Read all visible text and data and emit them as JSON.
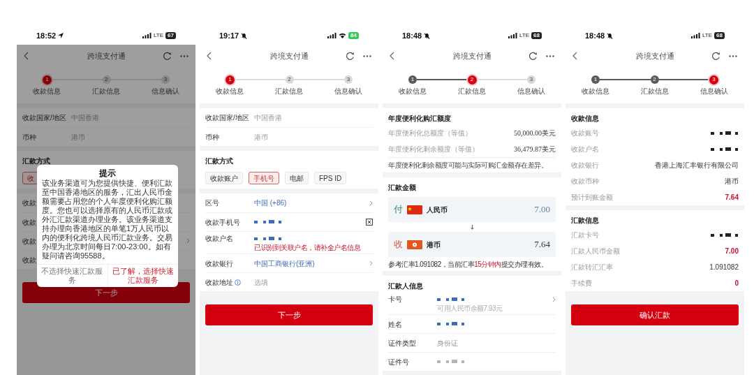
{
  "phones": [
    {
      "status": {
        "time": "18:52",
        "location_icon": true,
        "network": "LTE",
        "battery": "67",
        "charging": false
      },
      "title": "跨境支付通",
      "steps": [
        {
          "number": "1",
          "label": "收款信息",
          "done": false,
          "selected": true
        },
        {
          "number": "2",
          "label": "汇款信息",
          "done": false,
          "selected": false
        },
        {
          "number": "3",
          "label": "信息确认",
          "done": false,
          "selected": false
        }
      ],
      "sections": [
        {
          "kind": "form",
          "rows": [
            {
              "label": "收款国家/地区",
              "value": "中国香港",
              "kind": "muted"
            },
            {
              "label": "币种",
              "value": "港币",
              "kind": "muted"
            }
          ]
        },
        {
          "kind": "chips",
          "title": "汇款方式",
          "chips": [
            {
              "label": "收",
              "selected": true
            }
          ]
        },
        {
          "kind": "form",
          "rows": [
            {
              "label": "收款"
            },
            {
              "label": "收款"
            },
            {
              "label": "收款",
              "chevron": true
            },
            {
              "label": "收款"
            }
          ]
        },
        {
          "kind": "button",
          "label": "下一步"
        }
      ],
      "dialog": {
        "title": "提示",
        "body": "该业务渠道可为您提供快捷、便利汇款至中国香港地区的服务，汇出人民币金额需要占用您的个人年度便利化购汇额度。您也可以选择原有的人民币汇款或外汇汇款渠道办理业务。该业务渠道支持办理向香港地区的单笔1万人民币以内的便利化跨境人民币汇款业务。交易办理为北京时间每日7:00-23:00。如有疑问请咨询95588。",
        "buttons": [
          {
            "label": "不选择快速汇款服务",
            "kind": "secondary"
          },
          {
            "label": "已了解，选择快速汇款服务",
            "kind": "primary"
          }
        ]
      }
    },
    {
      "status": {
        "time": "19:17",
        "silent_icon": true,
        "wifi": true,
        "battery": "84",
        "charging": true
      },
      "title": "跨境支付通",
      "steps": [
        {
          "number": "1",
          "label": "收款信息",
          "done": false,
          "selected": true
        },
        {
          "number": "2",
          "label": "汇款信息",
          "done": false,
          "selected": false
        },
        {
          "number": "3",
          "label": "信息确认",
          "done": false,
          "selected": false
        }
      ],
      "sections": [
        {
          "kind": "form",
          "rows": [
            {
              "label": "收款国家/地区",
              "value": "中国香港",
              "kind": "muted"
            },
            {
              "label": "币种",
              "value": "港币",
              "kind": "muted"
            }
          ]
        },
        {
          "kind": "chips",
          "title": "汇款方式",
          "chips": [
            {
              "label": "收款账户",
              "selected": false
            },
            {
              "label": "手机号",
              "selected": true
            },
            {
              "label": "电邮",
              "selected": false
            },
            {
              "label": "FPS ID",
              "selected": false
            }
          ]
        },
        {
          "kind": "form",
          "rows": [
            {
              "label": "区号",
              "value": "中国 (+86)",
              "kind": "link",
              "chevron": true
            },
            {
              "label": "收款手机号",
              "masked": true,
              "kind": "link",
              "contact_icon": true
            },
            {
              "label": "收款户名",
              "masked": true,
              "kind": "link",
              "note": "已识别到关联户名，请补全户名信息",
              "note_error": true
            },
            {
              "label": "收款银行",
              "value": "中国工商银行(亚洲)",
              "kind": "link",
              "chevron": true
            },
            {
              "label": "收款地址",
              "info_icon": true,
              "placeholder": "选填"
            }
          ]
        },
        {
          "kind": "button",
          "label": "下一步"
        }
      ]
    },
    {
      "status": {
        "time": "18:48",
        "silent_icon": true,
        "network": "LTE",
        "battery": "68",
        "charging": false
      },
      "title": "跨境支付通",
      "steps": [
        {
          "number": "1",
          "label": "收款信息",
          "done": true,
          "selected": false
        },
        {
          "number": "2",
          "label": "汇款信息",
          "done": false,
          "selected": true
        },
        {
          "number": "3",
          "label": "信息确认",
          "done": false,
          "selected": false
        }
      ],
      "sections": [
        {
          "kind": "summary",
          "title": "年度便利化购汇额度",
          "rows": [
            {
              "label": "年度便利化总额度（等值）",
              "value": "50,000.00美元",
              "kind": "serif"
            },
            {
              "label": "年度便利化剩余额度（等值）",
              "value": "36,479.87美元",
              "kind": "serif"
            }
          ],
          "note": "年度便利化剩余额度可能与实际可购汇金额存在差异。"
        },
        {
          "kind": "exchange",
          "title": "汇款金额",
          "legs": [
            {
              "kind": "pay",
              "mark": "付",
              "currency": "人民币",
              "amount": "7.00"
            },
            {
              "kind": "receive",
              "mark": "收",
              "currency": "港币",
              "amount": "7.64"
            }
          ],
          "note_parts": [
            {
              "text": "参考汇率1.091082，当前汇率",
              "highlight": false
            },
            {
              "text": "15分钟内",
              "highlight": true
            },
            {
              "text": "提交办理有效。",
              "highlight": false
            }
          ]
        },
        {
          "kind": "form",
          "title": "汇款人信息",
          "rows": [
            {
              "label": "卡号",
              "masked": true,
              "kind": "link",
              "note": "可用人民币余额7.93元",
              "note_error": false,
              "chevron": true
            },
            {
              "label": "姓名",
              "masked": true,
              "kind": "link"
            },
            {
              "label": "证件类型",
              "value": "身份证",
              "kind": "muted"
            },
            {
              "label": "证件号",
              "masked": true,
              "kind": "muted"
            }
          ]
        }
      ]
    },
    {
      "status": {
        "time": "18:48",
        "silent_icon": true,
        "network": "LTE",
        "battery": "68",
        "charging": false
      },
      "title": "跨境支付通",
      "steps": [
        {
          "number": "1",
          "label": "收款信息",
          "done": true,
          "selected": false
        },
        {
          "number": "2",
          "label": "汇款信息",
          "done": true,
          "selected": false
        },
        {
          "number": "3",
          "label": "信息确认",
          "done": false,
          "selected": true
        }
      ],
      "sections": [
        {
          "kind": "summary",
          "title": "收款信息",
          "rows": [
            {
              "label": "收款账号",
              "masked": true,
              "kind": "plain"
            },
            {
              "label": "收款户名",
              "masked": true,
              "kind": "plain"
            },
            {
              "label": "收款银行",
              "value": "香港上海汇丰银行有限公司",
              "kind": "plain"
            },
            {
              "label": "收款币种",
              "value": "港币",
              "kind": "plain"
            },
            {
              "label": "预计到账金额",
              "value": "7.64",
              "kind": "emphasis"
            }
          ]
        },
        {
          "kind": "summary",
          "title": "汇款信息",
          "rows": [
            {
              "label": "汇款卡号",
              "masked": true,
              "kind": "plain"
            },
            {
              "label": "汇款人民币金额",
              "value": "7.00",
              "kind": "emphasis"
            },
            {
              "label": "汇款转汇汇率",
              "value": "1.091082",
              "kind": "plain"
            },
            {
              "label": "手续费",
              "value": "0",
              "kind": "emphasis"
            }
          ]
        },
        {
          "kind": "button",
          "label": "确认汇款"
        }
      ]
    }
  ]
}
